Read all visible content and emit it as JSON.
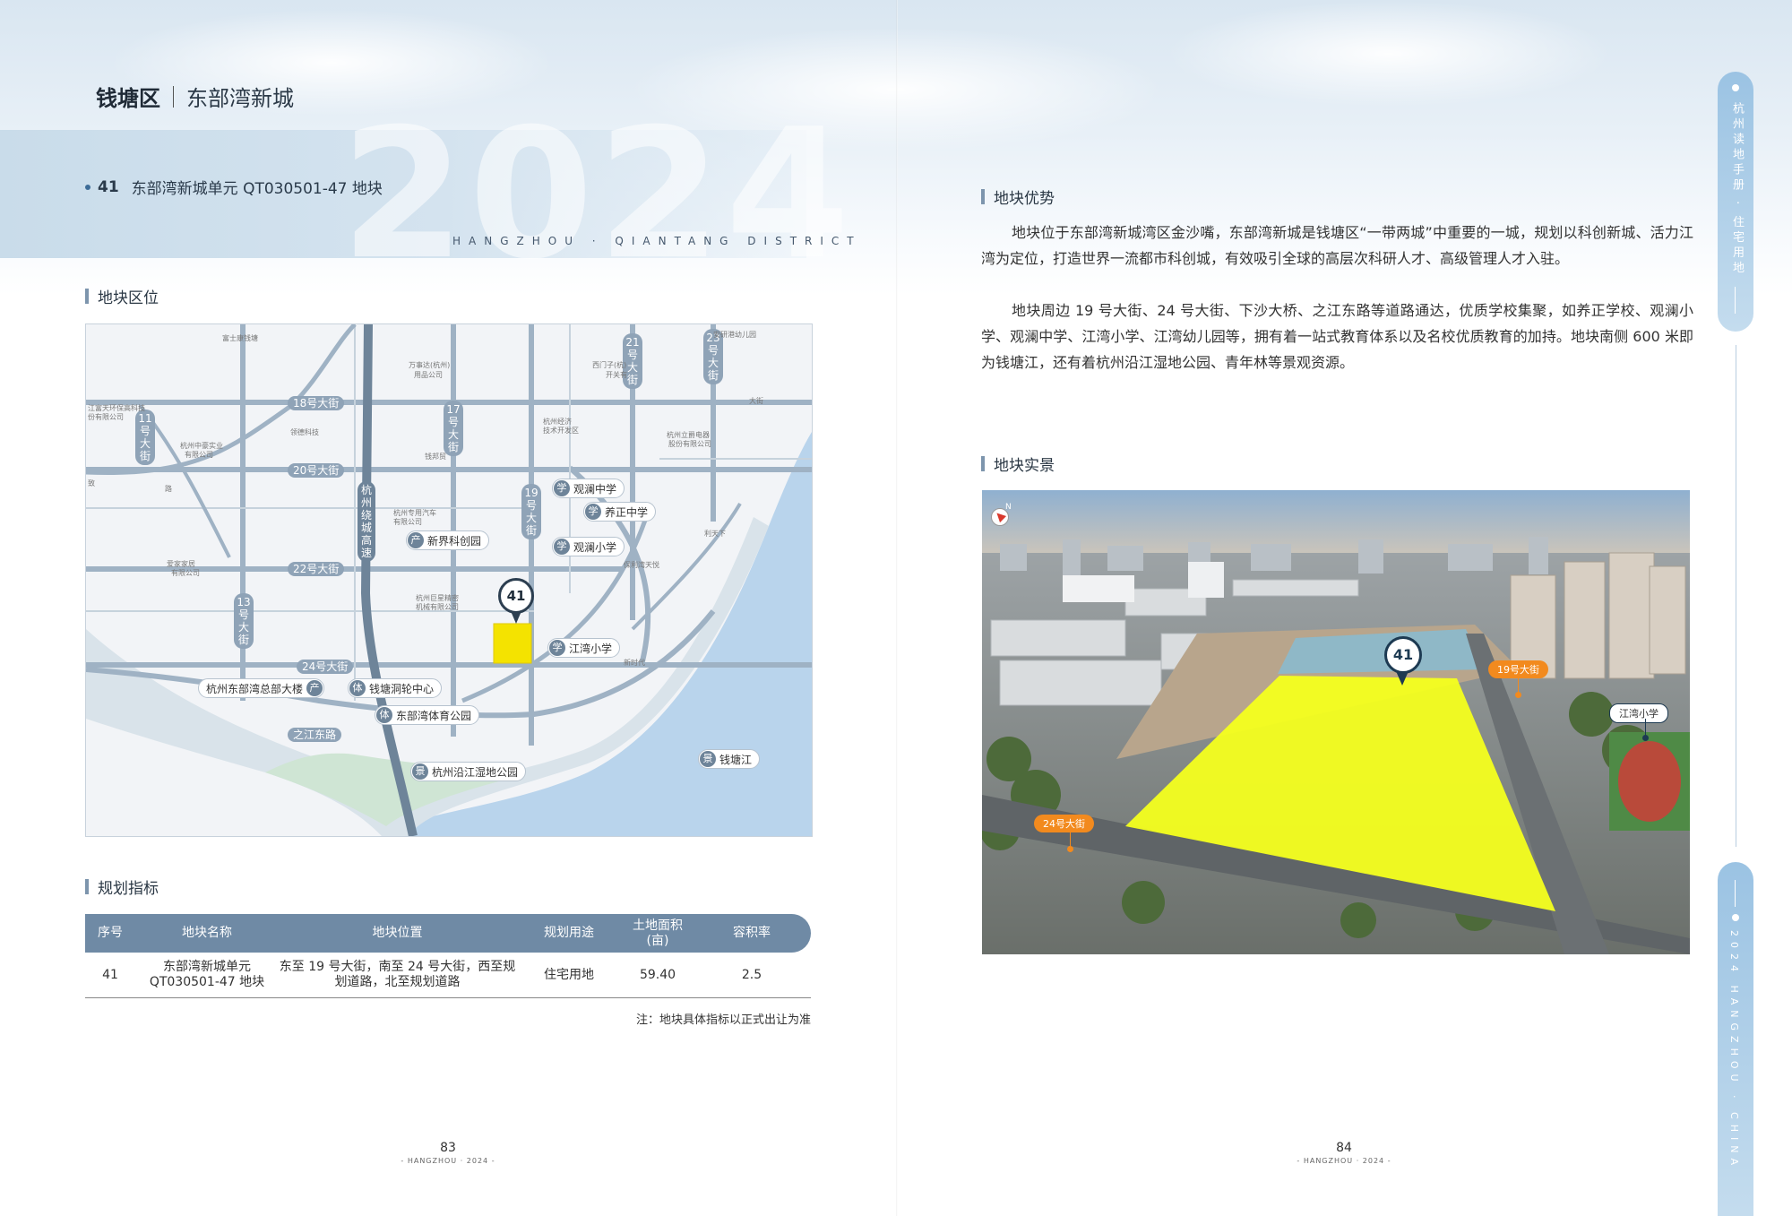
{
  "left_page": {
    "district": "钱塘区",
    "sub_district": "东部湾新城",
    "year_watermark": "2024",
    "banner_english": "HANGZHOU · QIANTANG DISTRICT",
    "parcel_number": "41",
    "parcel_title": "东部湾新城单元 QT030501-47 地块",
    "location_heading": "地块区位",
    "map": {
      "marker_label": "41",
      "roads": [
        "18号大街",
        "20号大街",
        "22号大街",
        "24号大街",
        "之江东路",
        "11号大街",
        "13号大街",
        "17号大街",
        "19号大街",
        "21号大街",
        "23号大街",
        "杭州绕城高速",
        "之江东路"
      ],
      "pois": [
        {
          "type": "学",
          "name": "观澜中学"
        },
        {
          "type": "学",
          "name": "养正中学"
        },
        {
          "type": "学",
          "name": "观澜小学"
        },
        {
          "type": "学",
          "name": "江湾小学"
        },
        {
          "type": "产",
          "name": "新界科创园"
        },
        {
          "type": "产",
          "name": "杭州东部湾总部大楼"
        },
        {
          "type": "体",
          "name": "钱塘洞轮中心"
        },
        {
          "type": "体",
          "name": "东部湾体育公园"
        },
        {
          "type": "景",
          "name": "杭州沿江湿地公园"
        },
        {
          "type": "景",
          "name": "钱塘江"
        }
      ],
      "minor_labels": [
        "富士康钱塘",
        "万事达(杭州)",
        "用品公司",
        "西门子(杭)",
        "开关有",
        "杭州经济",
        "技术开发区",
        "钱邦贸",
        "杭州专用汽车",
        "有限公司",
        "杭州巨星精密",
        "机械有限公司",
        "保利湾天悦",
        "新时代",
        "杭州中豪实业",
        "有限公司",
        "领德科技",
        "江富天环保高科技",
        "份有限公司",
        "路",
        "致",
        "杭州立爵电器",
        "股份有限公司",
        "安研港幼儿园",
        "大街",
        "爱家家居",
        "有限公司",
        "利天下"
      ]
    },
    "planning_heading": "规划指标",
    "table": {
      "headers": [
        "序号",
        "地块名称",
        "地块位置",
        "规划用途",
        "土地面积(亩)",
        "容积率"
      ],
      "rows": [
        [
          "41",
          "东部湾新城单元 QT030501-47 地块",
          "东至 19 号大街，南至 24 号大街，西至规划道路，北至规划道路",
          "住宅用地",
          "59.40",
          "2.5"
        ]
      ]
    },
    "note": "注：地块具体指标以正式出让为准",
    "page_number": "83",
    "page_sub": "- HANGZHOU · 2024 -"
  },
  "right_page": {
    "advantage_heading": "地块优势",
    "paragraph1": "地块位于东部湾新城湾区金沙嘴，东部湾新城是钱塘区“一带两城”中重要的一城，规划以科创新城、活力江湾为定位，打造世界一流都市科创城，有效吸引全球的高层次科研人才、高级管理人才入驻。",
    "paragraph2": "地块周边 19 号大街、24 号大街、下沙大桥、之江东路等道路通达，优质学校集聚，如养正学校、观澜小学、观澜中学、江湾小学、江湾幼儿园等，拥有着一站式教育体系以及名校优质教育的加持。地块南侧 600 米即为钱塘江，还有着杭州沿江湿地公园、青年林等景观资源。",
    "photo_heading": "地块实景",
    "photo": {
      "marker_label": "41",
      "tag_19": "19号大街",
      "tag_24": "24号大街",
      "tag_school": "江湾小学",
      "compass": "N"
    },
    "page_number": "84",
    "page_sub": "- HANGZHOU · 2024 -"
  },
  "sidebar": {
    "top_text": "杭州读地手册 · 住宅用地",
    "bottom_text": "2024 HANGZHOU · CHINA"
  },
  "colors": {
    "accent_blue": "#6f8aa5",
    "parcel_yellow": "#f4e300",
    "tag_orange": "#f28a1e"
  }
}
